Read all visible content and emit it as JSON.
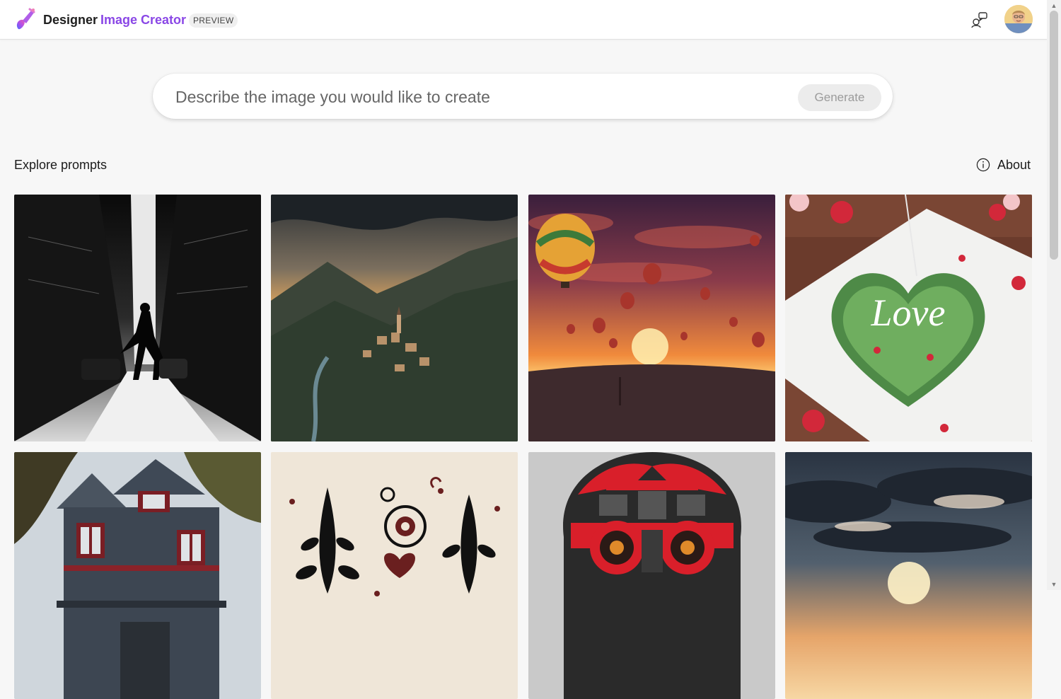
{
  "header": {
    "brand": "Designer",
    "product": "Image Creator",
    "badge": "PREVIEW"
  },
  "search": {
    "placeholder": "Describe the image you would like to create",
    "value": "",
    "generate_label": "Generate"
  },
  "explore": {
    "title": "Explore prompts",
    "about_label": "About"
  },
  "cards": [
    {
      "subject": "noir figure running down a dark alley"
    },
    {
      "subject": "mountain valley town under stormy sky"
    },
    {
      "subject": "hot air balloons over sunset city"
    },
    {
      "subject": "paper-cut green heart with love lettering"
    },
    {
      "subject": "victorian house under trees"
    },
    {
      "subject": "folk art floral pattern"
    },
    {
      "subject": "red and black robotic face"
    },
    {
      "subject": "sunset sky over sea"
    }
  ],
  "colors": {
    "accent": "#8a47e6",
    "background": "#f7f7f7"
  }
}
